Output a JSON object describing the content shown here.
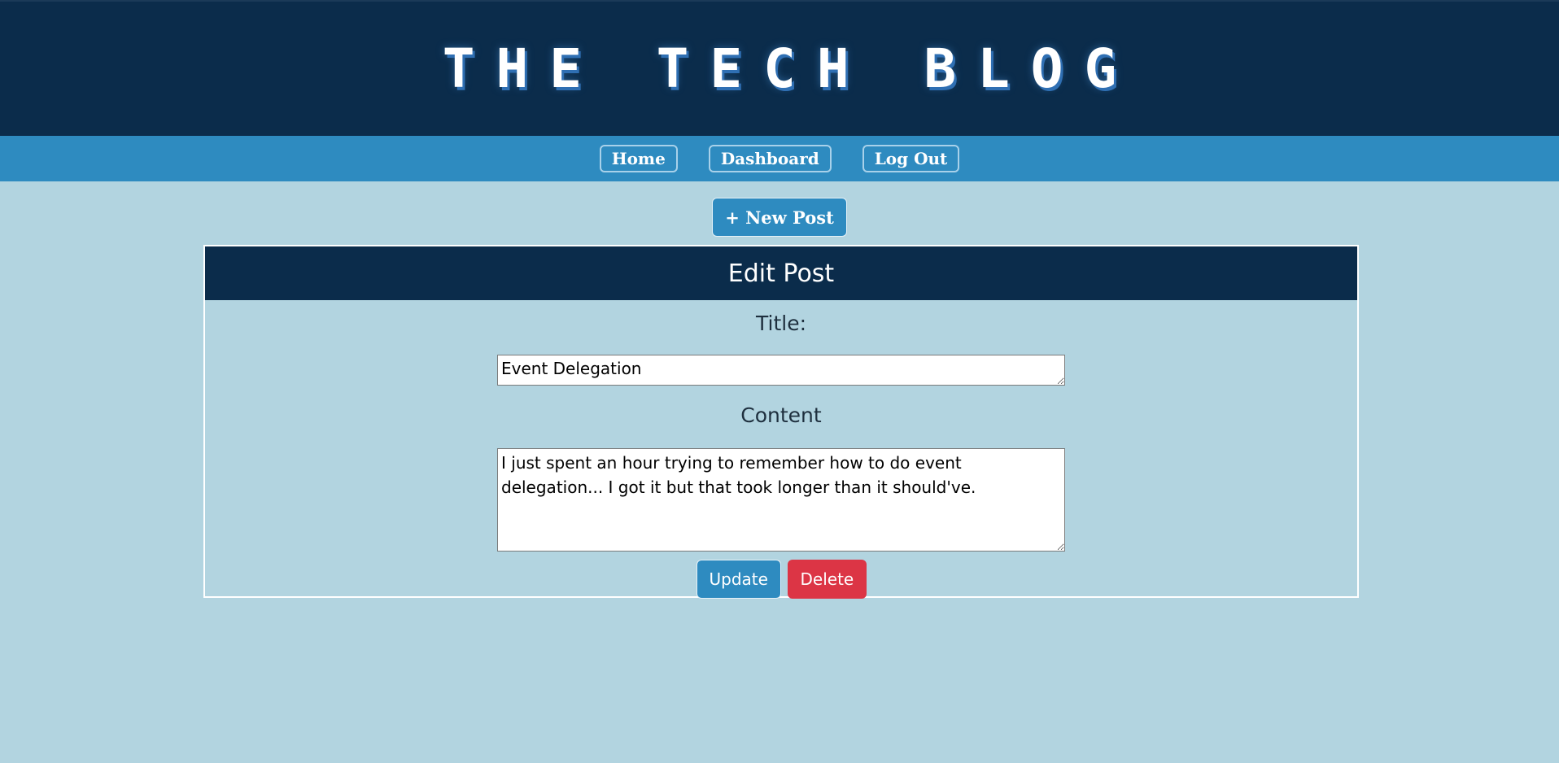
{
  "header": {
    "site_title": "THE TECH BLOG"
  },
  "nav": {
    "items": [
      {
        "label": "Home"
      },
      {
        "label": "Dashboard"
      },
      {
        "label": "Log Out"
      }
    ]
  },
  "toolbar": {
    "new_post_label": "+ New Post"
  },
  "edit_post": {
    "heading": "Edit Post",
    "title_label": "Title:",
    "title_value": "Event Delegation",
    "content_label": "Content",
    "content_value": "I just spent an hour trying to remember how to do event delegation... I got it but that took longer than it should've.",
    "update_label": "Update",
    "delete_label": "Delete"
  },
  "colors": {
    "page_background": "#b2d4e0",
    "header_background": "#0b2c4b",
    "nav_background": "#2e8bc0",
    "primary_button": "#2e8bc0",
    "danger_button": "#dc3545"
  }
}
